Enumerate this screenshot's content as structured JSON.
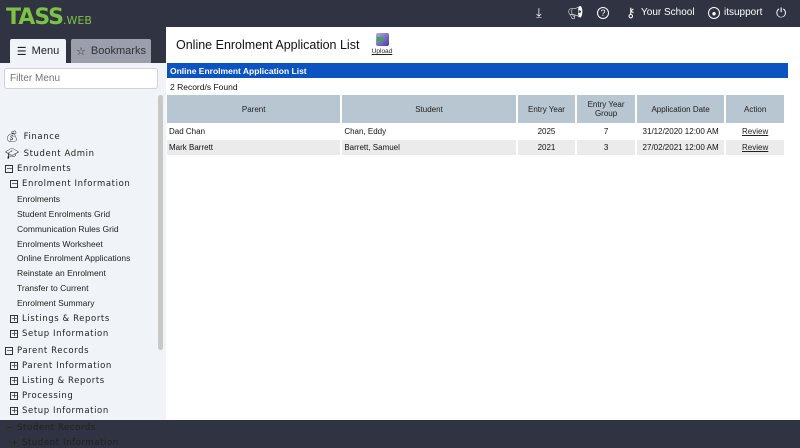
{
  "header": {
    "logo": "TASS",
    "logo_suffix": ".WEB",
    "school": "Your School",
    "user": "itsupport",
    "icons": [
      "download-tray-icon",
      "megaphone-icon",
      "help-icon",
      "key-icon",
      "user-circle-icon",
      "power-icon"
    ]
  },
  "sidebar": {
    "tabs": {
      "menu": "Menu",
      "bookmarks": "Bookmarks"
    },
    "filter_placeholder": "Filter Menu",
    "items": [
      {
        "label": "Finance",
        "level": 0,
        "icon": "money-bag-icon"
      },
      {
        "label": "Student Admin",
        "level": 0,
        "icon": "graduation-cap-icon"
      },
      {
        "label": "Enrolments",
        "level": 1,
        "toggle": "minus"
      },
      {
        "label": "Enrolment Information",
        "level": 2,
        "toggle": "minus"
      },
      {
        "label": "Enrolments",
        "level": 3
      },
      {
        "label": "Student Enrolments Grid",
        "level": 3
      },
      {
        "label": "Communication Rules Grid",
        "level": 3
      },
      {
        "label": "Enrolments Worksheet",
        "level": 3
      },
      {
        "label": "Online Enrolment Applications",
        "level": 3
      },
      {
        "label": "Reinstate an Enrolment",
        "level": 3
      },
      {
        "label": "Transfer to Current",
        "level": 3
      },
      {
        "label": "Enrolment Summary",
        "level": 3
      },
      {
        "label": "Listings & Reports",
        "level": 2,
        "toggle": "plus"
      },
      {
        "label": "Setup Information",
        "level": 2,
        "toggle": "plus"
      },
      {
        "label": "Parent Records",
        "level": 1,
        "toggle": "minus"
      },
      {
        "label": "Parent Information",
        "level": 2,
        "toggle": "plus"
      },
      {
        "label": "Listing & Reports",
        "level": 2,
        "toggle": "plus"
      },
      {
        "label": "Processing",
        "level": 2,
        "toggle": "plus"
      },
      {
        "label": "Setup Information",
        "level": 2,
        "toggle": "plus"
      },
      {
        "label": "Student Records",
        "level": 1,
        "toggle": "minus"
      },
      {
        "label": "Student Information",
        "level": 2,
        "toggle": "plus"
      }
    ]
  },
  "main": {
    "title": "Online Enrolment Application List",
    "upload_label": "Upload",
    "section_title": "Online Enrolment Application List",
    "records_found": "2 Record/s Found",
    "columns": [
      "Parent",
      "Student",
      "Entry Year",
      "Entry Year Group",
      "Application Date",
      "Action"
    ],
    "rows": [
      {
        "parent": "Dad Chan",
        "student": "Chan, Eddy",
        "entry_year": "2025",
        "group": "7",
        "date": "31/12/2020 12:00 AM",
        "action": "Review"
      },
      {
        "parent": "Mark Barrett",
        "student": "Barrett, Samuel",
        "entry_year": "2021",
        "group": "3",
        "date": "27/02/2021 12:00 AM",
        "action": "Review"
      }
    ]
  },
  "colors": {
    "header_bg": "#2f3342",
    "logo_green": "#7dc242",
    "section_blue": "#0b53c1",
    "table_header": "#b7c6d1"
  }
}
